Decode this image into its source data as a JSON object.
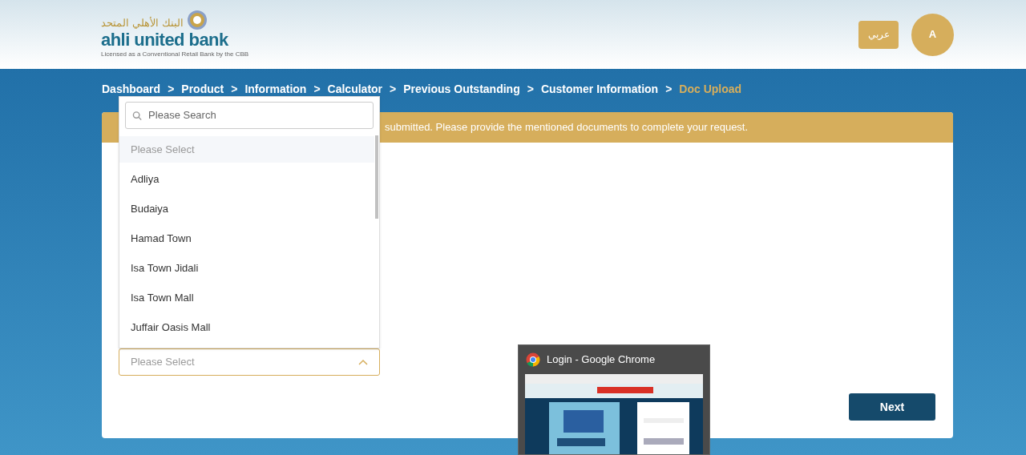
{
  "header": {
    "logo": {
      "arabic": "البنك الأهلي المتحد",
      "name": "ahli united bank",
      "tagline": "Licensed as a Conventional Retail Bank by the CBB"
    },
    "language_button": "عربي",
    "avatar": "A"
  },
  "breadcrumb": [
    {
      "label": "Dashboard",
      "selected": false
    },
    {
      "label": "Product",
      "selected": false
    },
    {
      "label": "Information",
      "selected": false
    },
    {
      "label": "Calculator",
      "selected": false
    },
    {
      "label": "Previous Outstanding",
      "selected": false
    },
    {
      "label": "Customer Information",
      "selected": false
    },
    {
      "label": "Doc Upload",
      "selected": true
    }
  ],
  "breadcrumb_separator": ">",
  "banner": "submitted. Please provide the mentioned documents to complete your request.",
  "dropdown": {
    "search_placeholder": "Please Search",
    "options": [
      {
        "label": "Please Select",
        "selected": true
      },
      {
        "label": "Adliya",
        "selected": false
      },
      {
        "label": "Budaiya",
        "selected": false
      },
      {
        "label": "Hamad Town",
        "selected": false
      },
      {
        "label": "Isa Town Jidali",
        "selected": false
      },
      {
        "label": "Isa Town Mall",
        "selected": false
      },
      {
        "label": "Juffair Oasis Mall",
        "selected": false
      }
    ],
    "placeholder": "Please Select",
    "expanded": true
  },
  "next_button": "Next",
  "taskbar_preview": {
    "title": "Login - Google Chrome"
  }
}
